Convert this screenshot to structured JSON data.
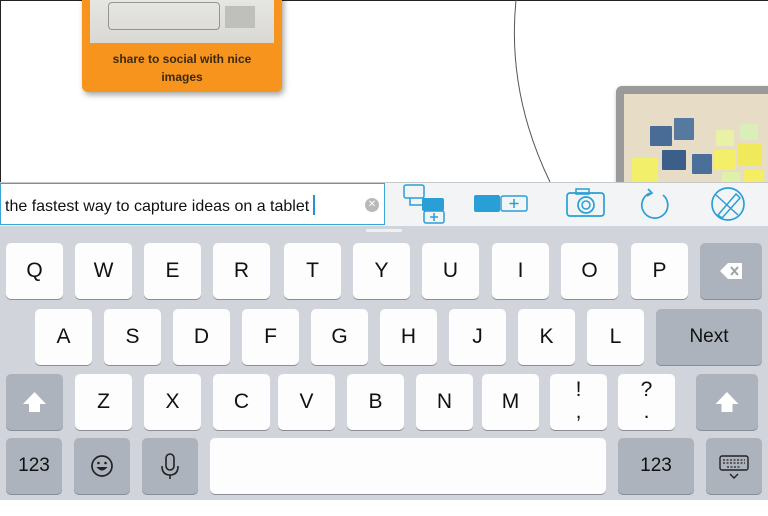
{
  "canvas": {
    "card_caption": "share to social with nice images"
  },
  "toolbar": {
    "text_value": "the fastest way to capture ideas on a tablet",
    "clear_icon": "clear-circle-x-icon",
    "tools": [
      "add-child-node-icon",
      "add-sibling-node-icon",
      "camera-icon",
      "refresh-icon",
      "pen-tool-icon"
    ],
    "accent": "#2a9fd6"
  },
  "keyboard": {
    "row1": [
      "Q",
      "W",
      "E",
      "R",
      "T",
      "Y",
      "U",
      "I",
      "O",
      "P"
    ],
    "row2": [
      "A",
      "S",
      "D",
      "F",
      "G",
      "H",
      "J",
      "K",
      "L"
    ],
    "row3": [
      "Z",
      "X",
      "C",
      "V",
      "B",
      "N",
      "M",
      "!\n,",
      "?\n."
    ],
    "next_label": "Next",
    "numbers_label": "123",
    "emoji_icon": "emoji-icon",
    "mic_icon": "microphone-icon",
    "shift_icon": "shift-arrow-icon",
    "backspace_icon": "backspace-icon",
    "dismiss_icon": "keyboard-dismiss-icon"
  }
}
